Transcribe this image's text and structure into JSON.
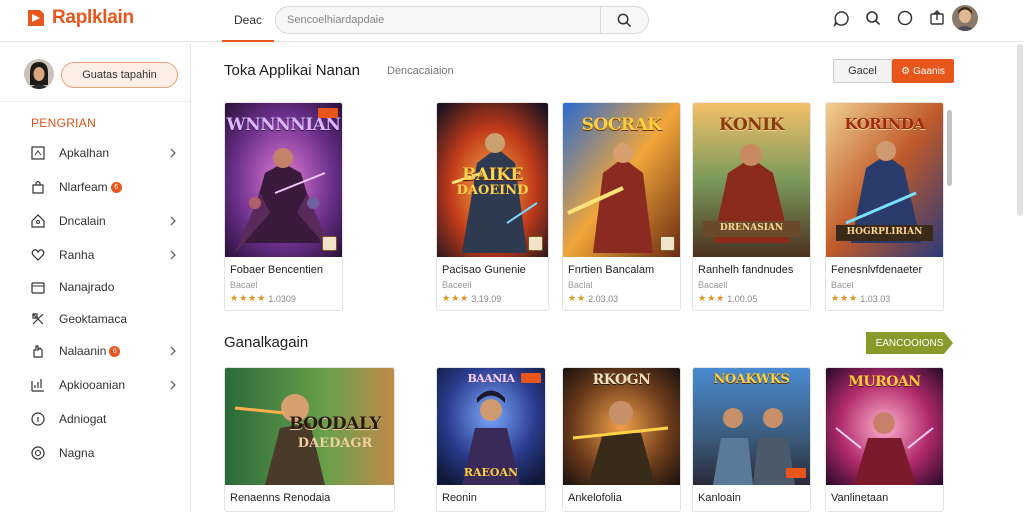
{
  "app": {
    "brand_name": "Raplklain"
  },
  "topbar": {
    "tab_label": "Deac",
    "search_placeholder": "Sencoelhiardapdaie",
    "icons": [
      "chat-icon",
      "search-icon",
      "circle-icon",
      "share-icon"
    ]
  },
  "sidebar": {
    "profile_button": "Guatas tapahin",
    "section_label": "PENGRIAN",
    "items": [
      {
        "label": "Apkalhan",
        "icon": "square-icon",
        "badge": "",
        "chevron": true
      },
      {
        "label": "Nlarfeam",
        "icon": "bag-icon",
        "badge": "6",
        "chevron": false
      },
      {
        "label": "Dncalain",
        "icon": "tag-icon",
        "badge": "",
        "chevron": true
      },
      {
        "label": "Ranha",
        "icon": "heart-icon",
        "badge": "",
        "chevron": true
      },
      {
        "label": "Nanajrado",
        "icon": "box-icon",
        "badge": "",
        "chevron": false
      },
      {
        "label": "Geoktamaca",
        "icon": "puzzle-icon",
        "badge": "",
        "chevron": false
      },
      {
        "label": "Nalaanin",
        "icon": "hand-icon",
        "badge": "6",
        "chevron": true
      },
      {
        "label": "Apkiooanian",
        "icon": "chart-icon",
        "badge": "",
        "chevron": true
      },
      {
        "label": "Adniogat",
        "icon": "info-icon",
        "badge": "",
        "chevron": false
      },
      {
        "label": "Nagna",
        "icon": "settings-icon",
        "badge": "",
        "chevron": false
      }
    ]
  },
  "section1": {
    "title": "Toka Applikai Nanan",
    "subtitle": "Dencacaiaion",
    "btn_outline": "Gacel",
    "btn_solid": "Gaanis"
  },
  "section2": {
    "title": "Ganalkagain",
    "tag": "EANCOOIONS"
  },
  "row1": [
    {
      "name": "Fobaer Bencentien",
      "meta": "Bacael",
      "rating": 4,
      "score": "1.0309",
      "art": "WNNNNIAN",
      "art2": ""
    },
    {
      "name": "Pacisao Gunenie",
      "meta": "Baceeil",
      "rating": 3,
      "score": "3.19.09",
      "art": "BAIKE",
      "art2": "DAOEIND"
    },
    {
      "name": "Fnrtien Bancalam",
      "meta": "Baclal",
      "rating": 2,
      "score": "2.03.03",
      "art": "SOCRAK",
      "art2": ""
    },
    {
      "name": "Ranhelh fandnudes",
      "meta": "Bacaell",
      "rating": 3,
      "score": "1.00.05",
      "art": "KONIK",
      "art2": "DRENASIAN"
    },
    {
      "name": "Fenesnlvfdenaeter",
      "meta": "Bacel",
      "rating": 3,
      "score": "1.03.03",
      "art": "KORINDA",
      "art2": "HOGRPLIRIAN"
    }
  ],
  "row2": [
    {
      "name": "Renaenns Renodaia",
      "art": "BOODALY",
      "art2": "DAEDAGR"
    },
    {
      "name": "Reonin",
      "art": "BAANIA",
      "art2": "RAEOAN"
    },
    {
      "name": "Ankelofolia",
      "art": "RKOGN",
      "art2": ""
    },
    {
      "name": "Kanloain",
      "art": "NOAKWKS",
      "art2": ""
    },
    {
      "name": "Vanlinetaan",
      "art": "MUROAN",
      "art2": ""
    }
  ]
}
